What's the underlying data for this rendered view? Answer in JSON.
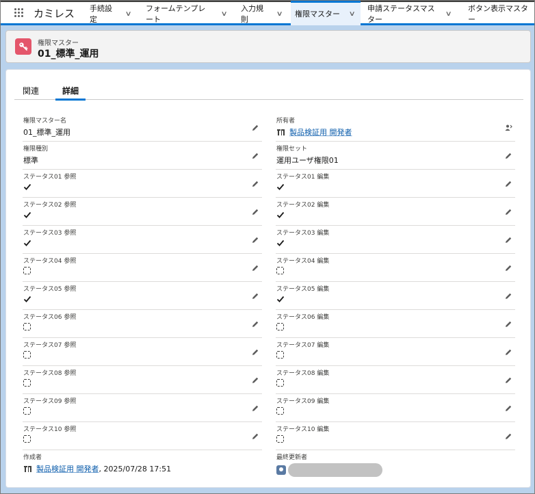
{
  "app": {
    "name": "カミレス",
    "nav": [
      {
        "label": "手続設定",
        "active": false
      },
      {
        "label": "フォームテンプレート",
        "active": false
      },
      {
        "label": "入力規則",
        "active": false
      },
      {
        "label": "権限マスター",
        "active": true
      },
      {
        "label": "申請ステータスマスター",
        "active": false
      },
      {
        "label": "ボタン表示マスター",
        "active": false
      }
    ]
  },
  "header": {
    "object_label": "権限マスター",
    "record_title": "01_標準_運用",
    "icon": "key-icon",
    "icon_color": "#e4566b"
  },
  "tabs": [
    {
      "label": "関連",
      "active": false
    },
    {
      "label": "詳細",
      "active": true
    }
  ],
  "left_fields": [
    {
      "label": "権限マスター名",
      "value": "01_標準_運用"
    },
    {
      "label": "権限種別",
      "value": "標準"
    },
    {
      "label": "ステータス01 参照",
      "checked": true
    },
    {
      "label": "ステータス02 参照",
      "checked": true
    },
    {
      "label": "ステータス03 参照",
      "checked": true
    },
    {
      "label": "ステータス04 参照",
      "checked": false
    },
    {
      "label": "ステータス05 参照",
      "checked": true
    },
    {
      "label": "ステータス06 参照",
      "checked": false
    },
    {
      "label": "ステータス07 参照",
      "checked": false
    },
    {
      "label": "ステータス08 参照",
      "checked": false
    },
    {
      "label": "ステータス09 参照",
      "checked": false
    },
    {
      "label": "ステータス10 参照",
      "checked": false
    },
    {
      "label": "作成者",
      "user": "製品検証用 開発者",
      "suffix": ", 2025/07/28 17:51"
    }
  ],
  "right_fields": [
    {
      "label": "所有者",
      "user": "製品検証用 開発者"
    },
    {
      "label": "権限セット",
      "value": "運用ユーザ権限01"
    },
    {
      "label": "ステータス01 編集",
      "checked": true
    },
    {
      "label": "ステータス02 編集",
      "checked": true
    },
    {
      "label": "ステータス03 編集",
      "checked": true
    },
    {
      "label": "ステータス04 編集",
      "checked": false
    },
    {
      "label": "ステータス05 編集",
      "checked": true
    },
    {
      "label": "ステータス06 編集",
      "checked": false
    },
    {
      "label": "ステータス07 編集",
      "checked": false
    },
    {
      "label": "ステータス08 編集",
      "checked": false
    },
    {
      "label": "ステータス09 編集",
      "checked": false
    },
    {
      "label": "ステータス10 編集",
      "checked": false
    },
    {
      "label": "最終更新者",
      "redacted": true
    }
  ],
  "colors": {
    "brand": "#0176d3",
    "link": "#0b5cab",
    "background": "#b9d2ec"
  }
}
